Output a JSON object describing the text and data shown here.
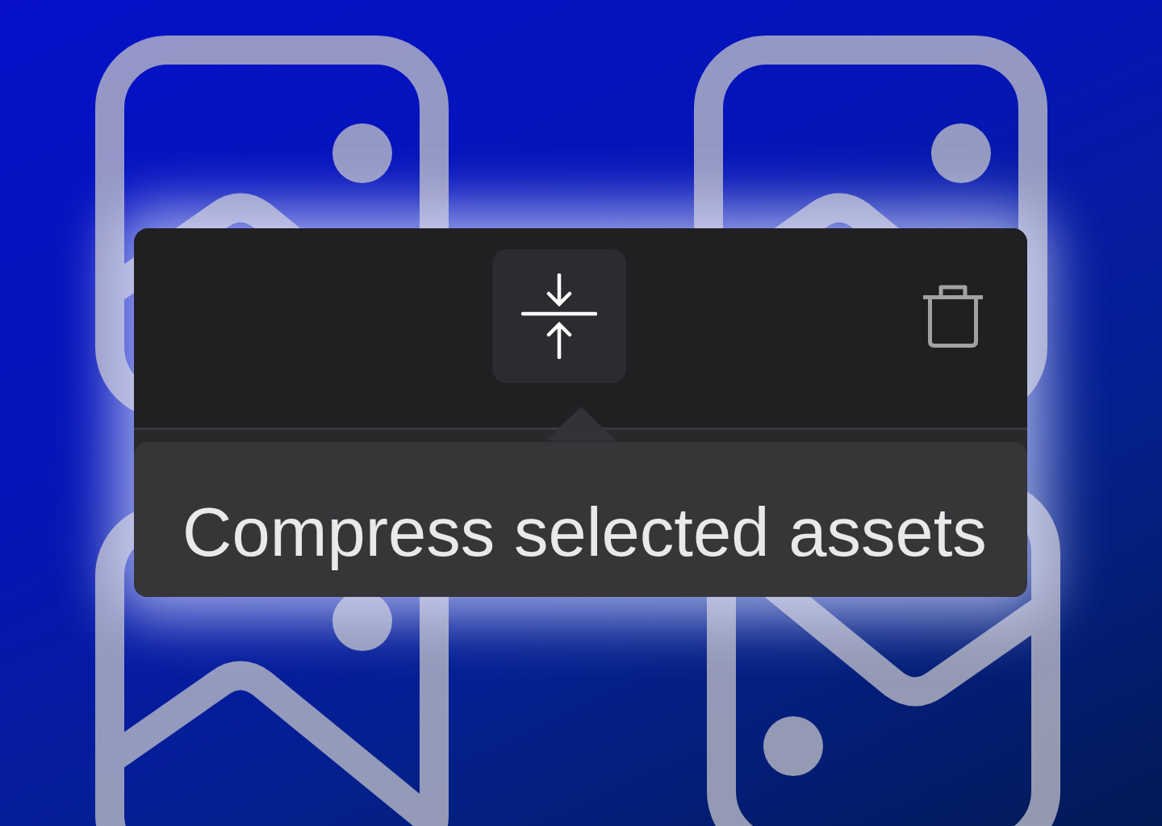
{
  "toolbar": {
    "center": [
      {
        "kind": "compress",
        "highlighted": true
      }
    ],
    "right": [
      {
        "kind": "delete",
        "highlighted": false
      }
    ]
  },
  "tooltip": {
    "text": "Compress selected assets"
  }
}
